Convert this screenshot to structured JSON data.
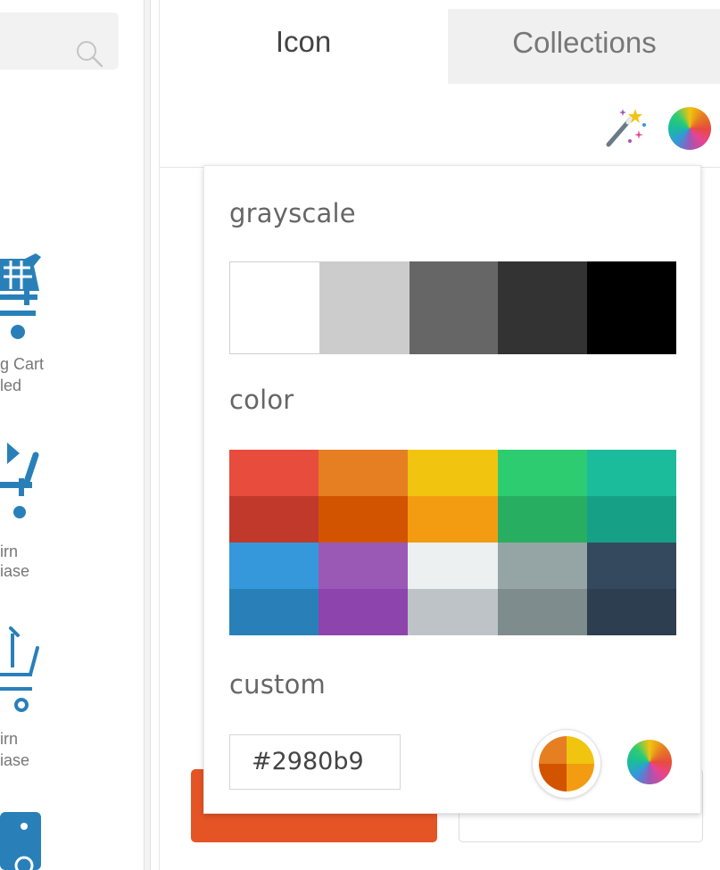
{
  "search": {
    "icon": "search-icon"
  },
  "icon_list": [
    {
      "label_line1": "g Cart",
      "label_line2": "led",
      "icon": "shopping-cart-filled-icon"
    },
    {
      "label_line1": "irn",
      "label_line2": "iase",
      "icon": "return-purchase-icon"
    },
    {
      "label_line1": "irn",
      "label_line2": "iase",
      "icon": "return-purchase-outline-icon"
    },
    {
      "icon": "price-tag-icon"
    }
  ],
  "tabs": {
    "icon": "Icon",
    "collections": "Collections"
  },
  "toolbar": {
    "magic_wand_icon": "magic-wand-icon",
    "color_wheel_icon": "color-wheel-icon"
  },
  "color_picker": {
    "grayscale_title": "grayscale",
    "grayscale": [
      "#ffffff",
      "#cccccc",
      "#666666",
      "#333333",
      "#000000"
    ],
    "color_title": "color",
    "colors": [
      "#e74c3c",
      "#e67e22",
      "#f1c40f",
      "#2ecc71",
      "#1abc9c",
      "#c0392b",
      "#d35400",
      "#f39c12",
      "#27ae60",
      "#16a085",
      "#3498db",
      "#9b59b6",
      "#ecf0f1",
      "#95a5a6",
      "#34495e",
      "#2980b9",
      "#8e44ad",
      "#bdc3c7",
      "#7f8c8d",
      "#2c3e50"
    ],
    "custom_title": "custom",
    "custom_value": "#2980b9",
    "current_color_quadrants": [
      "#e67e22",
      "#f1c40f",
      "#d35400",
      "#f39c12"
    ]
  },
  "colors": {
    "accent_orange": "#e55425",
    "icon_blue": "#2980b9"
  }
}
